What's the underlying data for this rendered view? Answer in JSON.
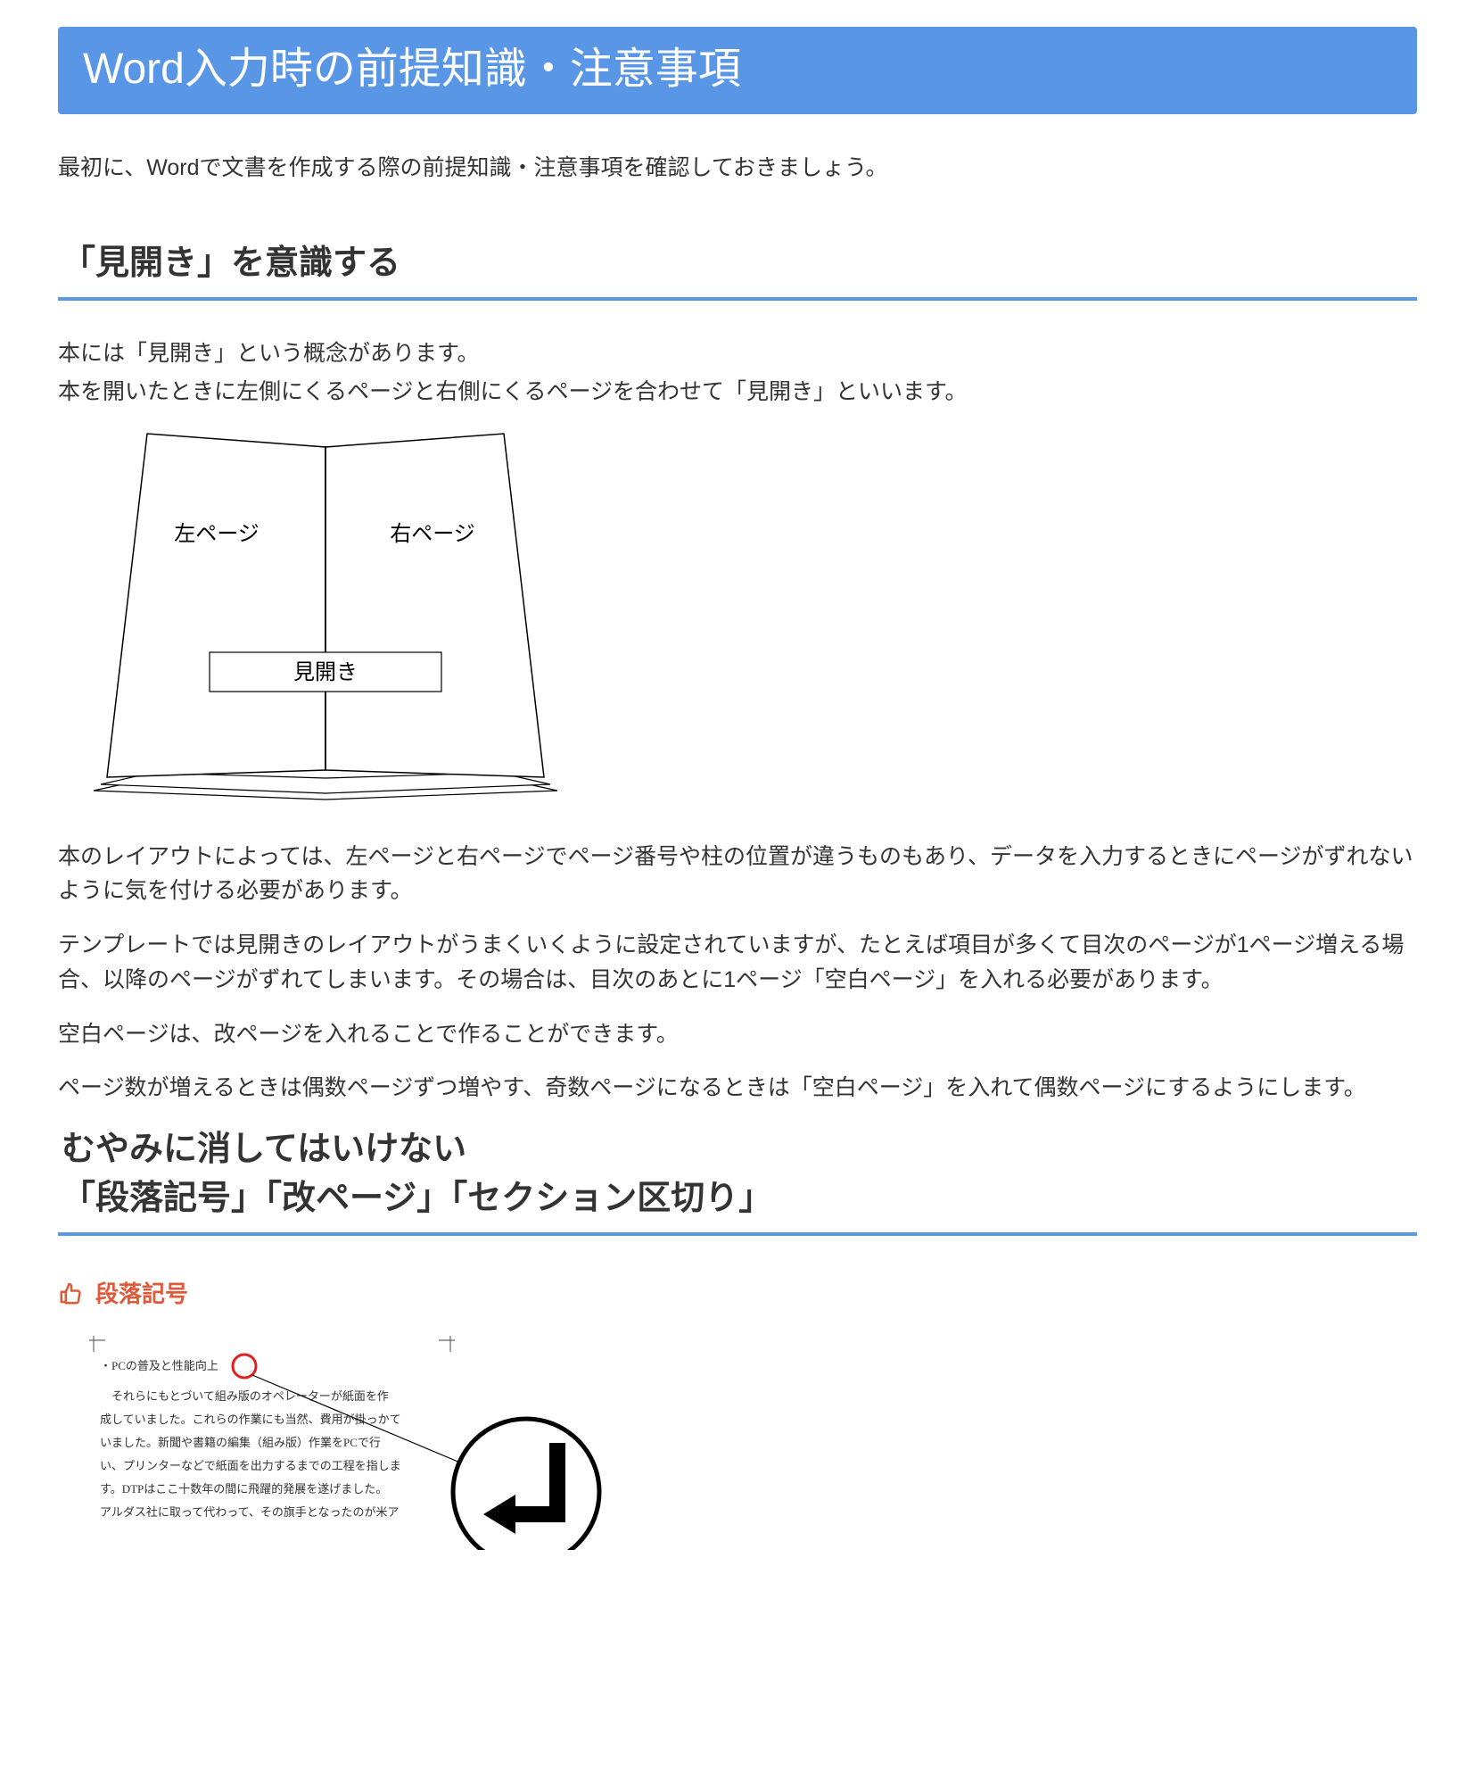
{
  "header": {
    "title": "Word入力時の前提知識・注意事項"
  },
  "intro": "最初に、Wordで文書を作成する際の前提知識・注意事項を確認しておきましょう。",
  "section1": {
    "heading": "「見開き」を意識する",
    "p1": "本には「見開き」という概念があります。",
    "p2": "本を開いたときに左側にくるページと右側にくるページを合わせて「見開き」といいます。",
    "diagram": {
      "left": "左ページ",
      "right": "右ページ",
      "spread": "見開き"
    },
    "p3": "本のレイアウトによっては、左ページと右ページでページ番号や柱の位置が違うものもあり、データを入力するときにページがずれないように気を付ける必要があります。",
    "p4": "テンプレートでは見開きのレイアウトがうまくいくように設定されていますが、たとえば項目が多くて目次のページが1ページ増える場合、以降のページがずれてしまいます。その場合は、目次のあとに1ページ「空白ページ」を入れる必要があります。",
    "p5": "空白ページは、改ページを入れることで作ることができます。",
    "p6": "ページ数が増えるときは偶数ページずつ増やす、奇数ページになるときは「空白ページ」を入れて偶数ページにするようにします。"
  },
  "section2": {
    "heading_l1": "むやみに消してはいけない",
    "heading_l2": "「段落記号」「改ページ」「セクション区切り」",
    "subheading": "段落記号",
    "shot": {
      "line1": "・PCの普及と性能向上",
      "line2": "それらにもとづいて組み版のオペレーターが紙面を作",
      "line3": "成していました。これらの作業にも当然、費用が掛っかて",
      "line4": "いました。新聞や書籍の編集（組み版）作業をPCで行",
      "line5": "い、プリンターなどで紙面を出力するまでの工程を指しま",
      "line6": "す。DTPはここ十数年の間に飛躍的発展を遂げました。",
      "line7": "アルダス社に取って代わって、その旗手となったのが米ア"
    }
  }
}
